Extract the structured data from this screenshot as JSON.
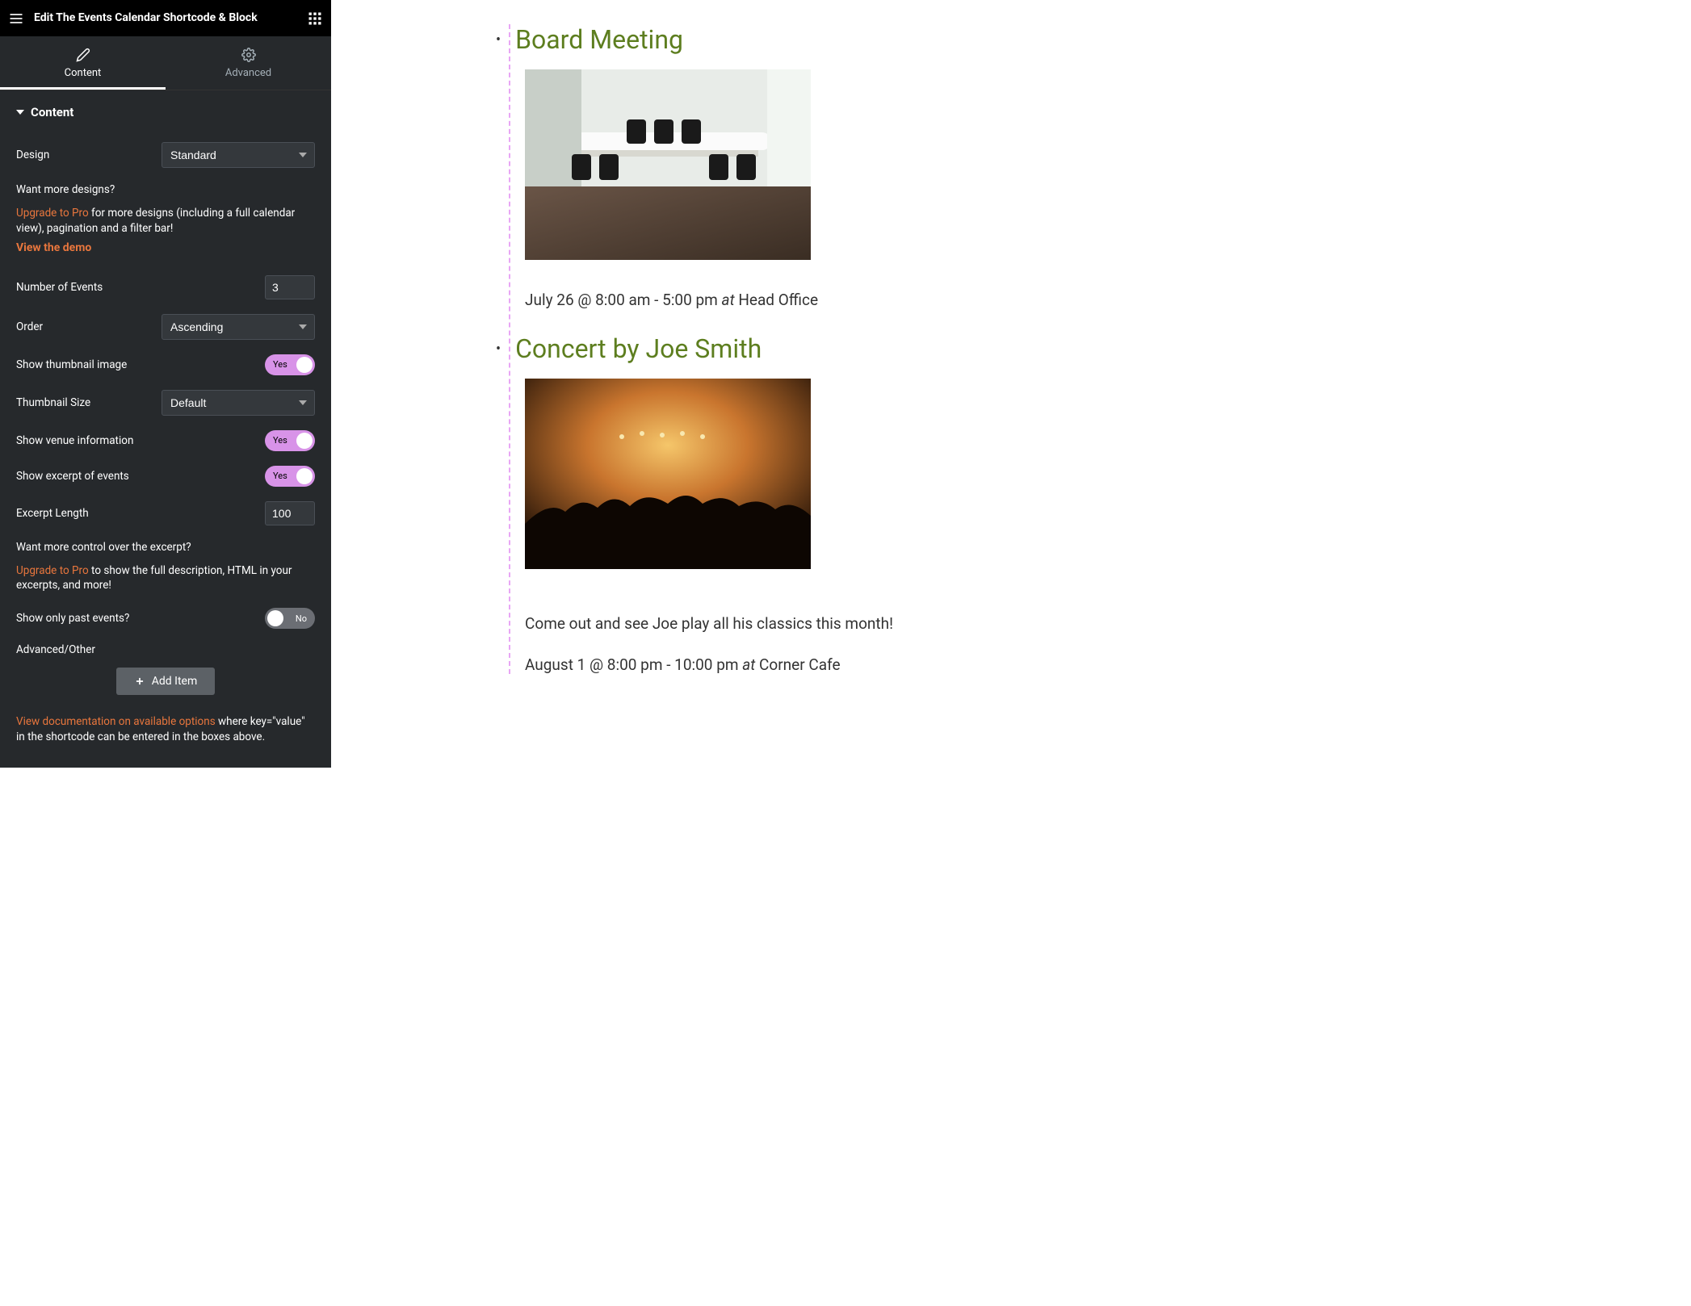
{
  "header": {
    "title": "Edit The Events Calendar Shortcode & Block"
  },
  "tabs": {
    "content": "Content",
    "advanced": "Advanced"
  },
  "section": {
    "title": "Content"
  },
  "controls": {
    "design_label": "Design",
    "design_value": "Standard",
    "more_designs": "Want more designs?",
    "upgrade": "Upgrade to Pro",
    "more_designs_text": " for more designs (including a full calendar view), pagination and a filter bar!",
    "view_demo": "View the demo",
    "num_events_label": "Number of Events",
    "num_events_value": "3",
    "order_label": "Order",
    "order_value": "Ascending",
    "thumb_label": "Show thumbnail image",
    "thumb_yes": "Yes",
    "thumbsize_label": "Thumbnail Size",
    "thumbsize_value": "Default",
    "venue_label": "Show venue information",
    "venue_yes": "Yes",
    "excerpt_label": "Show excerpt of events",
    "excerpt_yes": "Yes",
    "excerptlen_label": "Excerpt Length",
    "excerptlen_value": "100",
    "excerpt_control": "Want more control over the excerpt?",
    "excerpt_upgrade_text": " to show the full description, HTML in your excerpts, and more!",
    "past_label": "Show only past events?",
    "past_no": "No",
    "advanced_other": "Advanced/Other",
    "add_item": "Add Item",
    "doc_link": "View documentation on available options",
    "doc_text": " where key=\"value\" in the shortcode can be entered in the boxes above."
  },
  "events": [
    {
      "title": "Board Meeting",
      "date": "July 26 @ 8:00 am - 5:00 pm",
      "venue": "Head Office",
      "desc": ""
    },
    {
      "title": "Concert by Joe Smith",
      "date": "August 1 @ 8:00 pm - 10:00 pm",
      "venue": "Corner Cafe",
      "desc": "Come out and see Joe play all his classics this month!"
    }
  ]
}
